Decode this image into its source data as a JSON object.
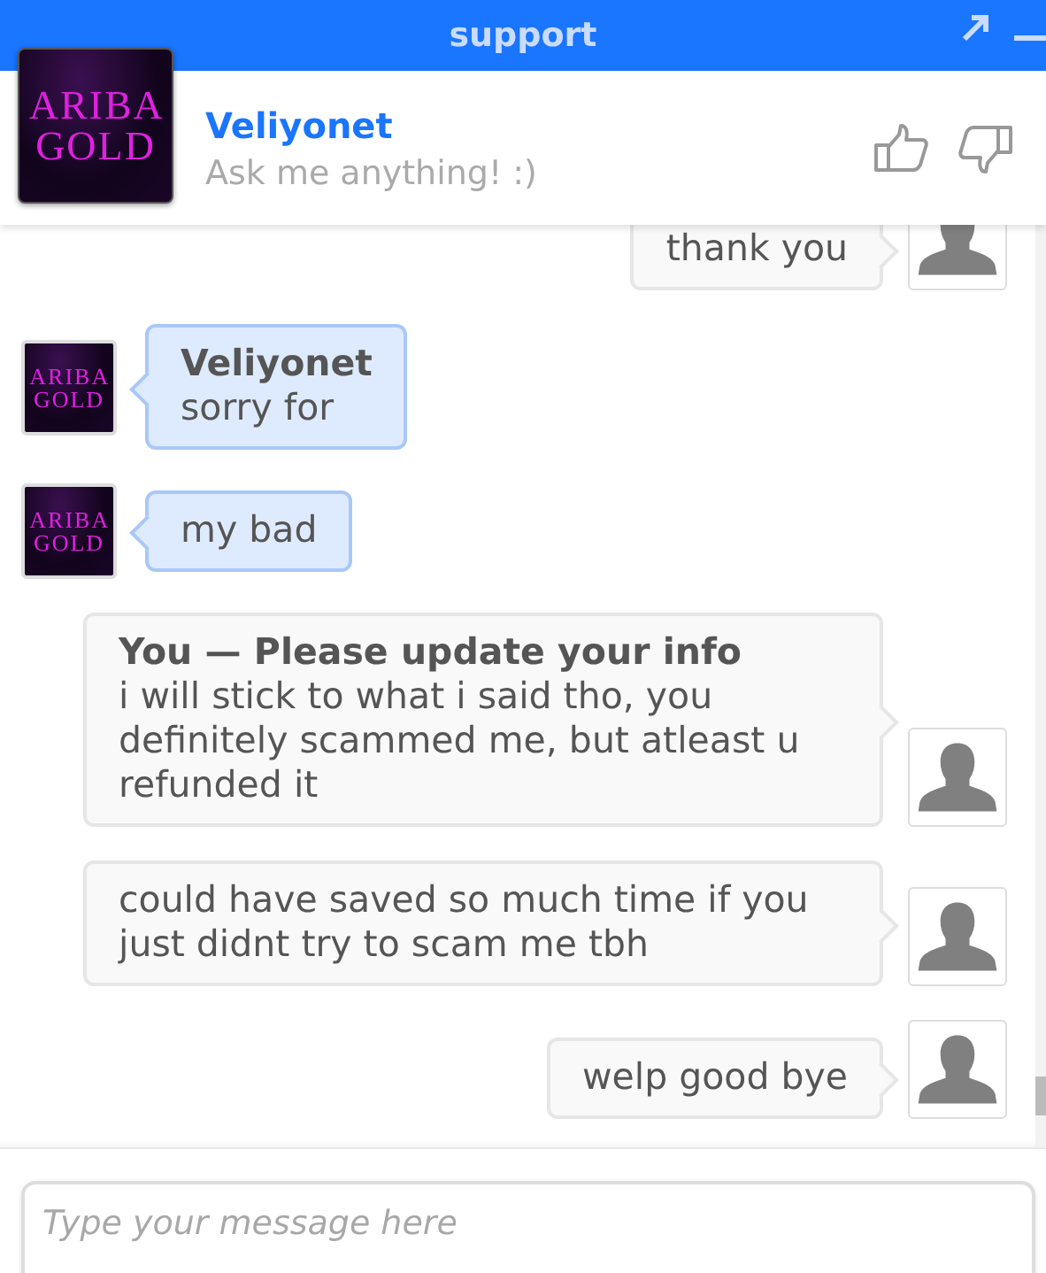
{
  "window": {
    "title": "support"
  },
  "header": {
    "logo": "ARIBA GOLD",
    "name": "Veliyonet",
    "subtitle": "Ask me anything! :)"
  },
  "messages": [
    {
      "kind": "user",
      "text": "thank you"
    },
    {
      "kind": "agent",
      "logo": "ARIBA GOLD",
      "sender": "Veliyonet",
      "text": "sorry for"
    },
    {
      "kind": "agent",
      "logo": "ARIBA GOLD",
      "text": "my bad"
    },
    {
      "kind": "user",
      "sender": "You — Please update your info",
      "text": "i will stick to what i said tho, you definitely scammed me, but atleast u refunded it"
    },
    {
      "kind": "user",
      "text": "could have saved so much time if you just didnt try to scam me tbh"
    },
    {
      "kind": "user",
      "text": "welp good bye"
    }
  ],
  "composer": {
    "placeholder": "Type your message here"
  }
}
